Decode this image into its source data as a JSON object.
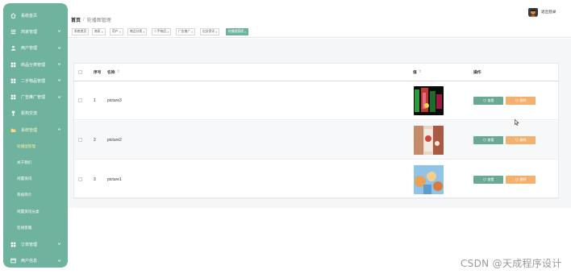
{
  "sidebar": {
    "items": [
      {
        "label": "系统首页",
        "icon": "home-icon",
        "chevron": false
      },
      {
        "label": "商家管理",
        "icon": "list-icon",
        "chevron": true
      },
      {
        "label": "用户管理",
        "icon": "user-icon",
        "chevron": true
      },
      {
        "label": "商品分类管理",
        "icon": "grid-icon",
        "chevron": true
      },
      {
        "label": "二手物品管理",
        "icon": "grid-icon",
        "chevron": true
      },
      {
        "label": "广告推广管理",
        "icon": "grid-icon",
        "chevron": true
      },
      {
        "label": "机构交流",
        "icon": "trophy-icon",
        "chevron": false
      },
      {
        "label": "系统管理",
        "icon": "folder-icon",
        "chevron": true
      }
    ],
    "subitems": [
      {
        "label": "轮播图管理"
      },
      {
        "label": "关于我们"
      },
      {
        "label": "闲置资讯"
      },
      {
        "label": "系统简介"
      },
      {
        "label": "闲置资讯分类"
      },
      {
        "label": "在线客服"
      }
    ],
    "bottom_items": [
      {
        "label": "订单管理",
        "icon": "grid-icon"
      },
      {
        "label": "用户信息",
        "icon": "window-icon"
      }
    ]
  },
  "breadcrumb": {
    "home": "首页",
    "separator": "/",
    "current": "轮播图管理"
  },
  "user": {
    "logout_label": "退出登录"
  },
  "tags": [
    {
      "label": "系统首页",
      "active": false
    },
    {
      "label": "商家",
      "active": false
    },
    {
      "label": "用户",
      "active": false
    },
    {
      "label": "商品分类",
      "active": false
    },
    {
      "label": "二手物品",
      "active": false
    },
    {
      "label": "广告推广",
      "active": false
    },
    {
      "label": "出交资讯",
      "active": false
    },
    {
      "label": "轮播图管理",
      "active": true
    }
  ],
  "tag_close": "×",
  "table": {
    "columns": {
      "index": "序号",
      "name": "名称",
      "value": "值",
      "actions": "操作"
    },
    "sort_glyph": "⇕",
    "rows": [
      {
        "index": "1",
        "name": "picture3",
        "view_label": "查看",
        "delete_label": "删除"
      },
      {
        "index": "2",
        "name": "picture2",
        "view_label": "查看",
        "delete_label": "删除"
      },
      {
        "index": "3",
        "name": "picture1",
        "view_label": "查看",
        "delete_label": "删除"
      }
    ]
  },
  "watermark": "CSDN @天成程序设计",
  "colors": {
    "sidebar": "#6fb39e",
    "view_button": "#6aa996",
    "delete_button": "#f3b06f"
  }
}
